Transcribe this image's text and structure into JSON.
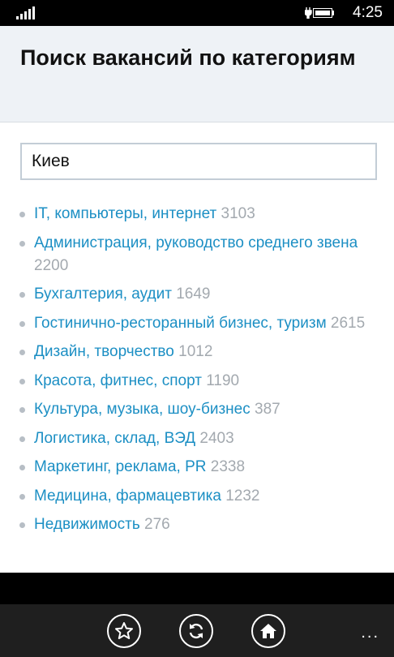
{
  "status_bar": {
    "time": "4:25",
    "icons": [
      "signal-icon",
      "battery-charging-icon"
    ]
  },
  "header": {
    "title": "Поиск вакансий по категориям"
  },
  "search": {
    "value": "Киев"
  },
  "categories": [
    {
      "label": "IT, компьютеры, интернет",
      "count": "3103"
    },
    {
      "label": "Администрация, руководство среднего звена",
      "count": "2200"
    },
    {
      "label": "Бухгалтерия, аудит",
      "count": "1649"
    },
    {
      "label": "Гостинично-ресторанный бизнес, туризм",
      "count": "2615"
    },
    {
      "label": "Дизайн, творчество",
      "count": "1012"
    },
    {
      "label": "Красота, фитнес, спорт",
      "count": "1190"
    },
    {
      "label": "Культура, музыка, шоу-бизнес",
      "count": "387"
    },
    {
      "label": "Логистика, склад, ВЭД",
      "count": "2403"
    },
    {
      "label": "Маркетинг, реклама, PR",
      "count": "2338"
    },
    {
      "label": "Медицина, фармацевтика",
      "count": "1232"
    },
    {
      "label": "Недвижимость",
      "count": "276"
    }
  ],
  "app_bar": {
    "buttons": [
      "star-icon",
      "refresh-icon",
      "home-icon"
    ],
    "more": "..."
  },
  "colors": {
    "link": "#1c8fc4",
    "count": "#a3a9af",
    "header_bg": "#eef2f6"
  }
}
